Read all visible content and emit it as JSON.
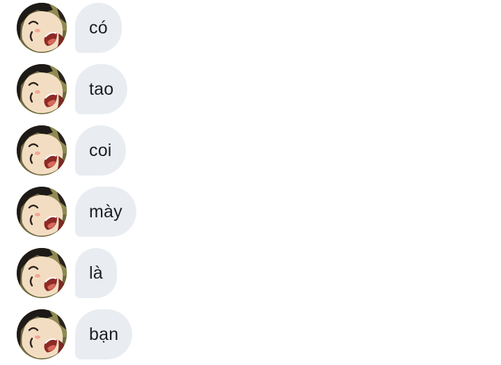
{
  "conversation": {
    "messages": [
      {
        "text": "có",
        "avatar_icon": "anime-boy-avatar"
      },
      {
        "text": "tao",
        "avatar_icon": "anime-boy-avatar"
      },
      {
        "text": "coi",
        "avatar_icon": "anime-boy-avatar"
      },
      {
        "text": "mày",
        "avatar_icon": "anime-boy-avatar"
      },
      {
        "text": "là",
        "avatar_icon": "anime-boy-avatar"
      },
      {
        "text": "bạn",
        "avatar_icon": "anime-boy-avatar"
      }
    ]
  },
  "colors": {
    "bubble_background": "#e9edf2",
    "message_text": "#1c1e21",
    "page_background": "#ffffff"
  }
}
